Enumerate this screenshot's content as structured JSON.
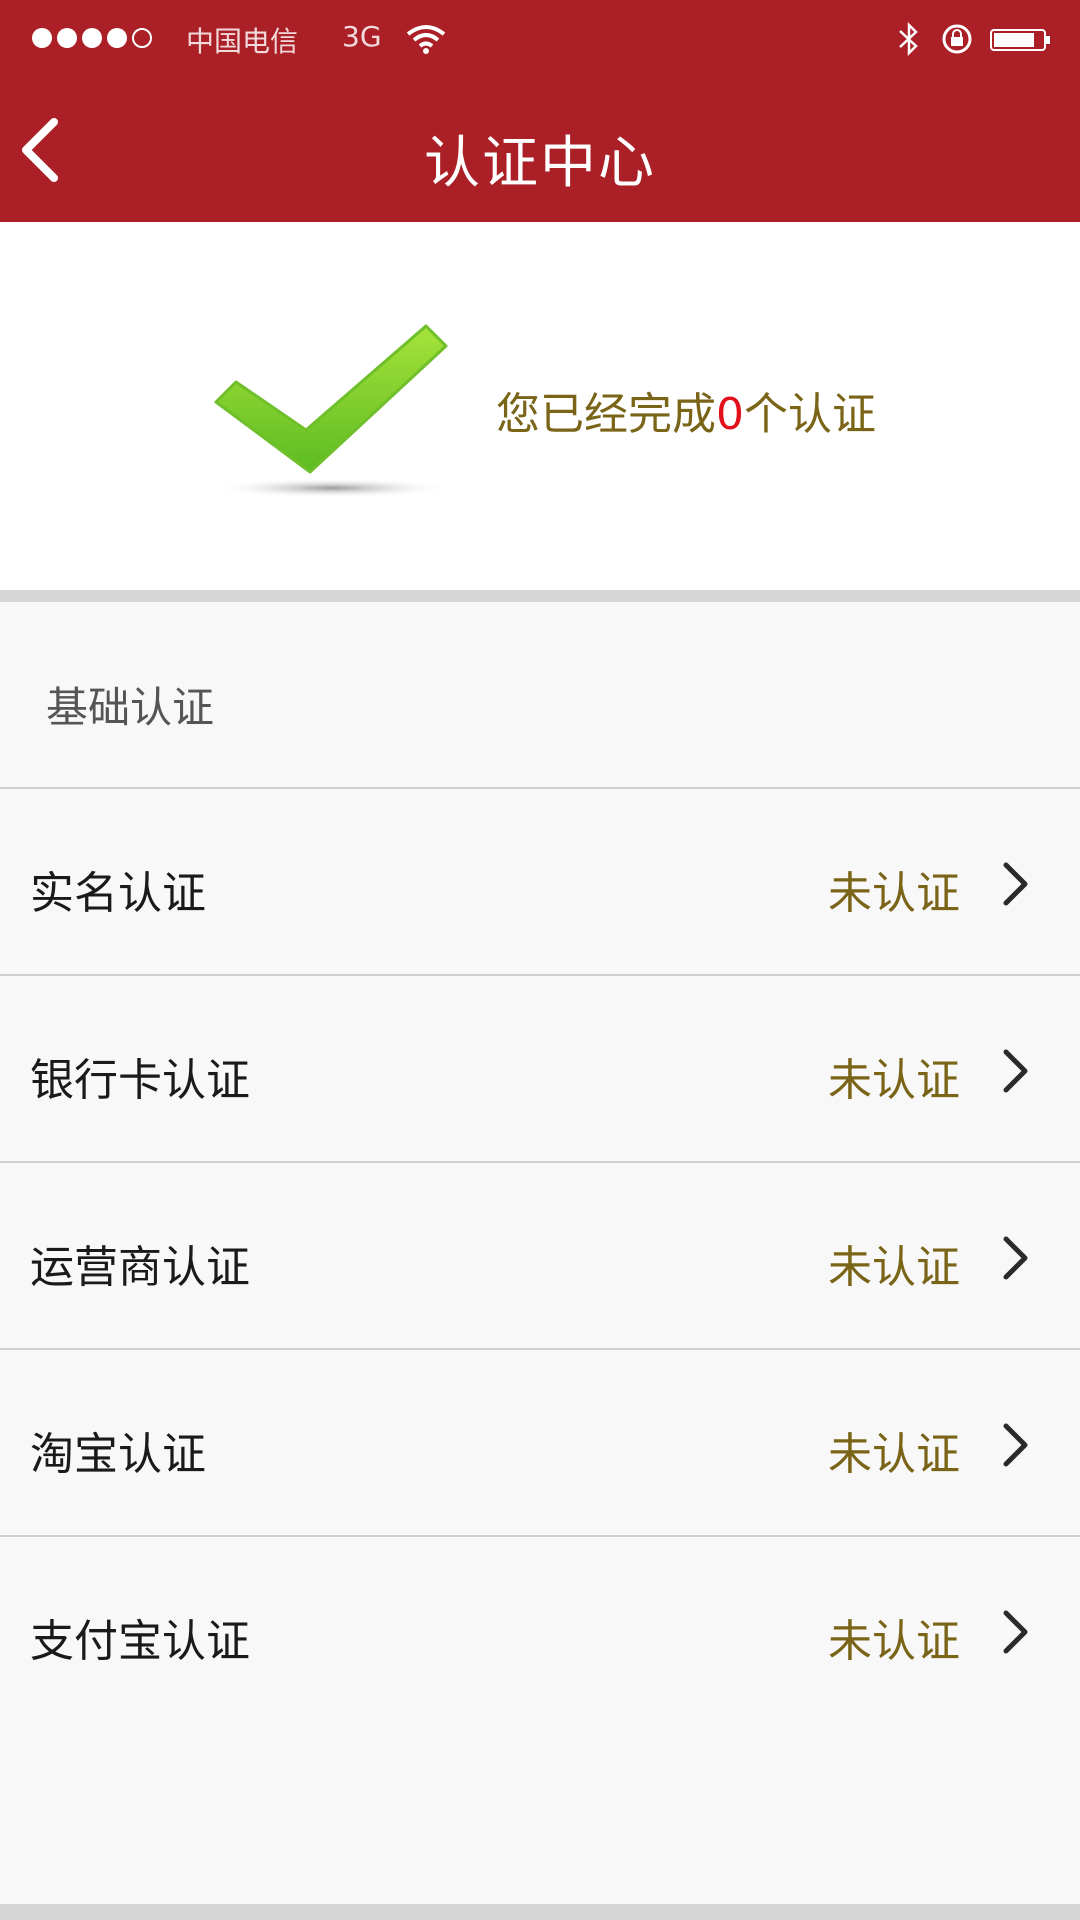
{
  "status_bar": {
    "carrier": "中国电信",
    "network": "3G",
    "icons": [
      "signal-dots-icon",
      "wifi-icon",
      "bluetooth-icon",
      "rotation-lock-icon",
      "battery-icon"
    ]
  },
  "nav": {
    "title": "认证中心",
    "back_icon": "chevron-left-icon"
  },
  "summary": {
    "prefix": "您已经完成",
    "count": "0",
    "suffix": "个认证",
    "icon": "green-checkmark-icon"
  },
  "section": {
    "title": "基础认证"
  },
  "items": [
    {
      "label": "实名认证",
      "status": "未认证"
    },
    {
      "label": "银行卡认证",
      "status": "未认证"
    },
    {
      "label": "运营商认证",
      "status": "未认证"
    },
    {
      "label": "淘宝认证",
      "status": "未认证"
    },
    {
      "label": "支付宝认证",
      "status": "未认证"
    }
  ],
  "colors": {
    "brand": "#ab1f27",
    "status_text": "#7a6418",
    "count_highlight": "#e1101a",
    "check_green": "#7fcf2a"
  }
}
